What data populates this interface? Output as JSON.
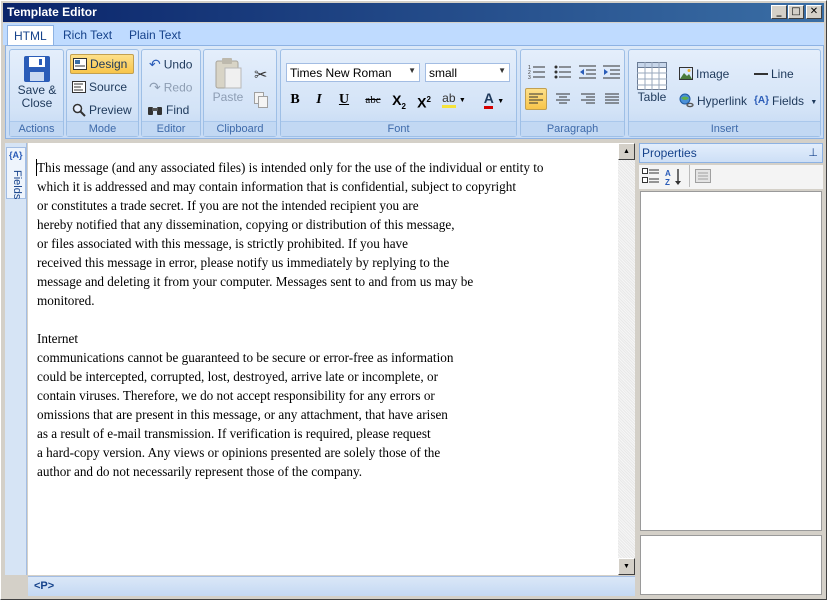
{
  "window": {
    "title": "Template Editor"
  },
  "tabs": [
    "HTML",
    "Rich Text",
    "Plain Text"
  ],
  "ribbon": {
    "actions": {
      "label": "Actions",
      "save_close": [
        "Save &",
        "Close"
      ]
    },
    "mode": {
      "label": "Mode",
      "design": "Design",
      "source": "Source",
      "preview": "Preview"
    },
    "editor": {
      "label": "Editor",
      "undo": "Undo",
      "redo": "Redo",
      "find": "Find"
    },
    "clipboard": {
      "label": "Clipboard",
      "paste": "Paste"
    },
    "font": {
      "label": "Font",
      "font_name": "Times New Roman",
      "font_size": "small",
      "bold": "B",
      "italic": "I",
      "underline": "U",
      "strike": "abc",
      "subscript": "X",
      "superscript": "X",
      "highlight": "ab",
      "color": "A"
    },
    "paragraph": {
      "label": "Paragraph"
    },
    "insert": {
      "label": "Insert",
      "table": "Table",
      "image": "Image",
      "line": "Line",
      "hyperlink": "Hyperlink",
      "fields": "Fields"
    }
  },
  "sidebar": {
    "fields_label": "Fields"
  },
  "document": {
    "lines": [
      "This message (and any associated files) is intended only for the use of the individual or entity to",
      "which it is addressed and may contain information that is confidential, subject to copyright",
      "or constitutes a trade secret. If you are not the intended recipient you are",
      "hereby notified that any dissemination, copying or distribution of this message,",
      "or files associated with this message, is strictly prohibited. If you have",
      "received this message in error, please notify us immediately by replying to the",
      "message and deleting it from your computer. Messages sent to and from us may be",
      "monitored.",
      "",
      "Internet",
      "communications cannot be guaranteed to be secure or error-free as information",
      "could be intercepted, corrupted, lost, destroyed, arrive late or incomplete, or",
      "contain viruses. Therefore, we do not accept responsibility for any errors or",
      "omissions that are present in this message, or any attachment, that have arisen",
      "as a result of e-mail transmission. If verification is required, please request",
      "a hard-copy version. Any views or opinions presented are solely those of the",
      "author and do not necessarily represent those of the company."
    ]
  },
  "status": {
    "tag": "<P>"
  },
  "properties": {
    "title": "Properties"
  }
}
